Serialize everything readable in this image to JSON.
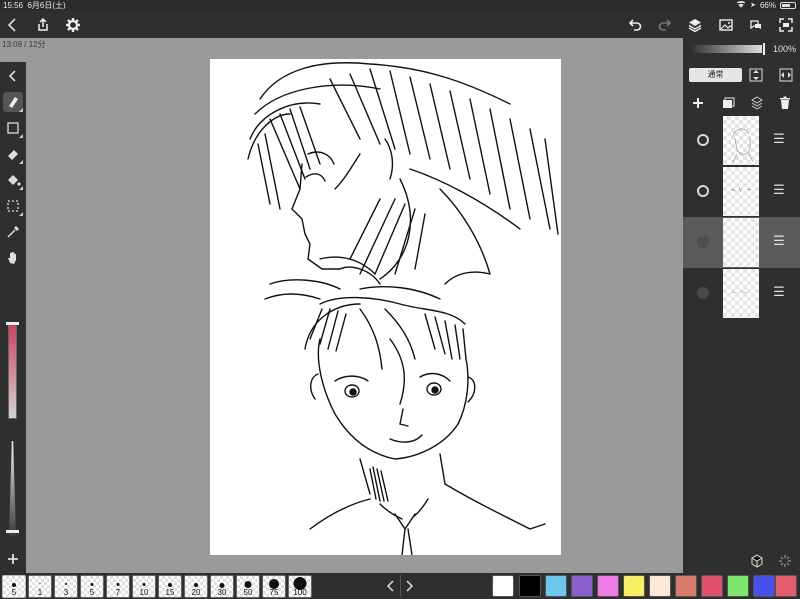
{
  "status": {
    "time": "15:56",
    "date": "6月6日(土)",
    "battery": "66%",
    "battery_level": 0.66
  },
  "timer": "13:08 / 12分",
  "layer_panel": {
    "opacity": "100%",
    "blend_mode": "通常"
  },
  "layers": [
    {
      "visible": true,
      "selected": false
    },
    {
      "visible": true,
      "selected": false
    },
    {
      "visible": false,
      "selected": true
    },
    {
      "visible": false,
      "selected": false
    }
  ],
  "brush_sizes": [
    "5",
    "1",
    "3",
    "5",
    "7",
    "10",
    "15",
    "20",
    "30",
    "50",
    "75",
    "100"
  ],
  "palette": [
    "#ffffff",
    "#000000",
    "#6ac8f0",
    "#8a5fd0",
    "#f07ae8",
    "#f8f060",
    "#fde9da",
    "#d97a6a",
    "#e0506e",
    "#7ee86a",
    "#4a50f0",
    "#e85a6e"
  ],
  "icons": {
    "back": "chevron-left-icon",
    "share": "share-icon",
    "settings": "gear-icon",
    "undo": "undo-icon",
    "redo": "redo-icon",
    "layers": "layers-icon",
    "image": "image-icon",
    "material": "material-icon",
    "fullscreen": "fullscreen-icon"
  }
}
